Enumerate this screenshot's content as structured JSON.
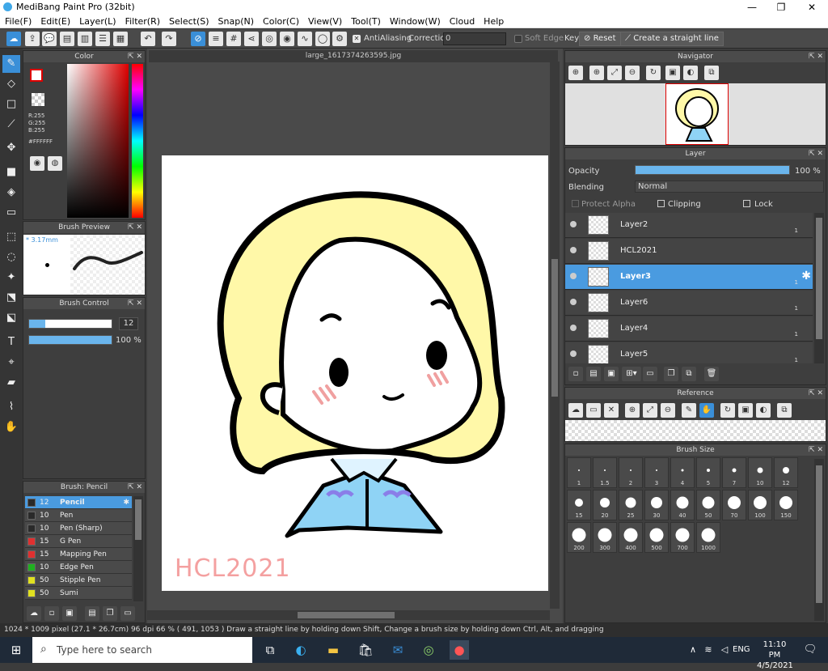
{
  "app": {
    "title": "MediBang Paint Pro (32bit)"
  },
  "menu": [
    "File(F)",
    "Edit(E)",
    "Layer(L)",
    "Filter(R)",
    "Select(S)",
    "Snap(N)",
    "Color(C)",
    "View(V)",
    "Tool(T)",
    "Window(W)",
    "Cloud",
    "Help"
  ],
  "toolbar": {
    "antialiasing": "AntiAliasing",
    "correction_label": "Correction",
    "correction_value": "0",
    "soft_edge": "Soft Edge",
    "key_label": "Key",
    "reset_label": "Reset",
    "straight_line_label": "Create a straight line"
  },
  "color_panel": {
    "title": "Color",
    "rgb": [
      "R:255",
      "G:255",
      "B:255"
    ],
    "hex": "#FFFFFF"
  },
  "brush_preview": {
    "title": "Brush Preview",
    "size": "* 3.17mm"
  },
  "brush_control": {
    "title": "Brush Control",
    "size_value": "12",
    "opacity_value": "100 %",
    "size_fraction": 0.2,
    "opacity_fraction": 1.0
  },
  "brush_list": {
    "title": "Brush: Pencil",
    "items": [
      {
        "size": "12",
        "name": "Pencil",
        "color": "#2a2a2a",
        "selected": true
      },
      {
        "size": "10",
        "name": "Pen",
        "color": "#2a2a2a",
        "selected": false
      },
      {
        "size": "10",
        "name": "Pen (Sharp)",
        "color": "#2a2a2a",
        "selected": false
      },
      {
        "size": "15",
        "name": "G Pen",
        "color": "#e03030",
        "selected": false
      },
      {
        "size": "15",
        "name": "Mapping Pen",
        "color": "#e03030",
        "selected": false
      },
      {
        "size": "10",
        "name": "Edge Pen",
        "color": "#20b020",
        "selected": false
      },
      {
        "size": "50",
        "name": "Stipple Pen",
        "color": "#e0e020",
        "selected": false
      },
      {
        "size": "50",
        "name": "Sumi",
        "color": "#e0e020",
        "selected": false
      }
    ]
  },
  "canvas": {
    "doc_title": "large_1617374263595.jpg",
    "watermark": "HCL2021"
  },
  "navigator": {
    "title": "Navigator"
  },
  "layer_panel": {
    "title": "Layer",
    "opacity_label": "Opacity",
    "opacity_value": "100 %",
    "opacity_fraction": 1.0,
    "blending_label": "Blending",
    "blending_value": "Normal",
    "protect_alpha": "Protect Alpha",
    "clipping": "Clipping",
    "lock": "Lock",
    "layers": [
      {
        "name": "Layer2",
        "badge": "1",
        "selected": false
      },
      {
        "name": "HCL2021",
        "badge": "",
        "selected": false
      },
      {
        "name": "Layer3",
        "badge": "1",
        "selected": true
      },
      {
        "name": "Layer6",
        "badge": "1",
        "selected": false
      },
      {
        "name": "Layer4",
        "badge": "1",
        "selected": false
      },
      {
        "name": "Layer5",
        "badge": "1",
        "selected": false
      }
    ]
  },
  "reference": {
    "title": "Reference"
  },
  "brush_size": {
    "title": "Brush Size",
    "sizes": [
      "1",
      "1.5",
      "2",
      "3",
      "4",
      "5",
      "7",
      "10",
      "12",
      "15",
      "20",
      "25",
      "30",
      "40",
      "50",
      "70",
      "100",
      "150",
      "200",
      "300",
      "400",
      "500",
      "700",
      "1000"
    ]
  },
  "status": "1024 * 1009 pixel  (27.1 * 26.7cm)  96 dpi  66 %  ( 491, 1053 )  Draw a straight line by holding down Shift, Change a brush size by holding down Ctrl, Alt, and dragging",
  "taskbar": {
    "search_placeholder": "Type here to search",
    "lang": "ENG",
    "time": "11:10 PM",
    "date": "4/5/2021"
  }
}
